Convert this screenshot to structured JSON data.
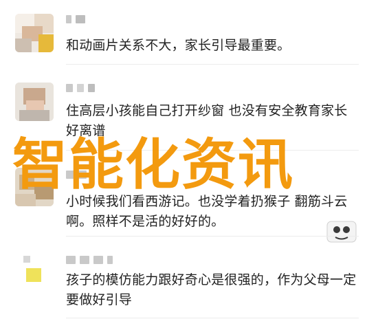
{
  "overlay": {
    "title": "智能化资讯",
    "color": "#f39a0f"
  },
  "comments": [
    {
      "text": "和动画片关系不大，家长引导最重要。"
    },
    {
      "text": "住高层小孩能自己打开纱窗 也没有安全教育家长好离谱"
    },
    {
      "text": "小时候我们看西游记。也没学着扔猴子 翻筋斗云啊。照样不是活的好好的。"
    },
    {
      "text": "孩子的模仿能力跟好奇心是很强的，作为父母一定要做好引导"
    }
  ],
  "icons": {
    "sticker": "sticker-icon"
  }
}
